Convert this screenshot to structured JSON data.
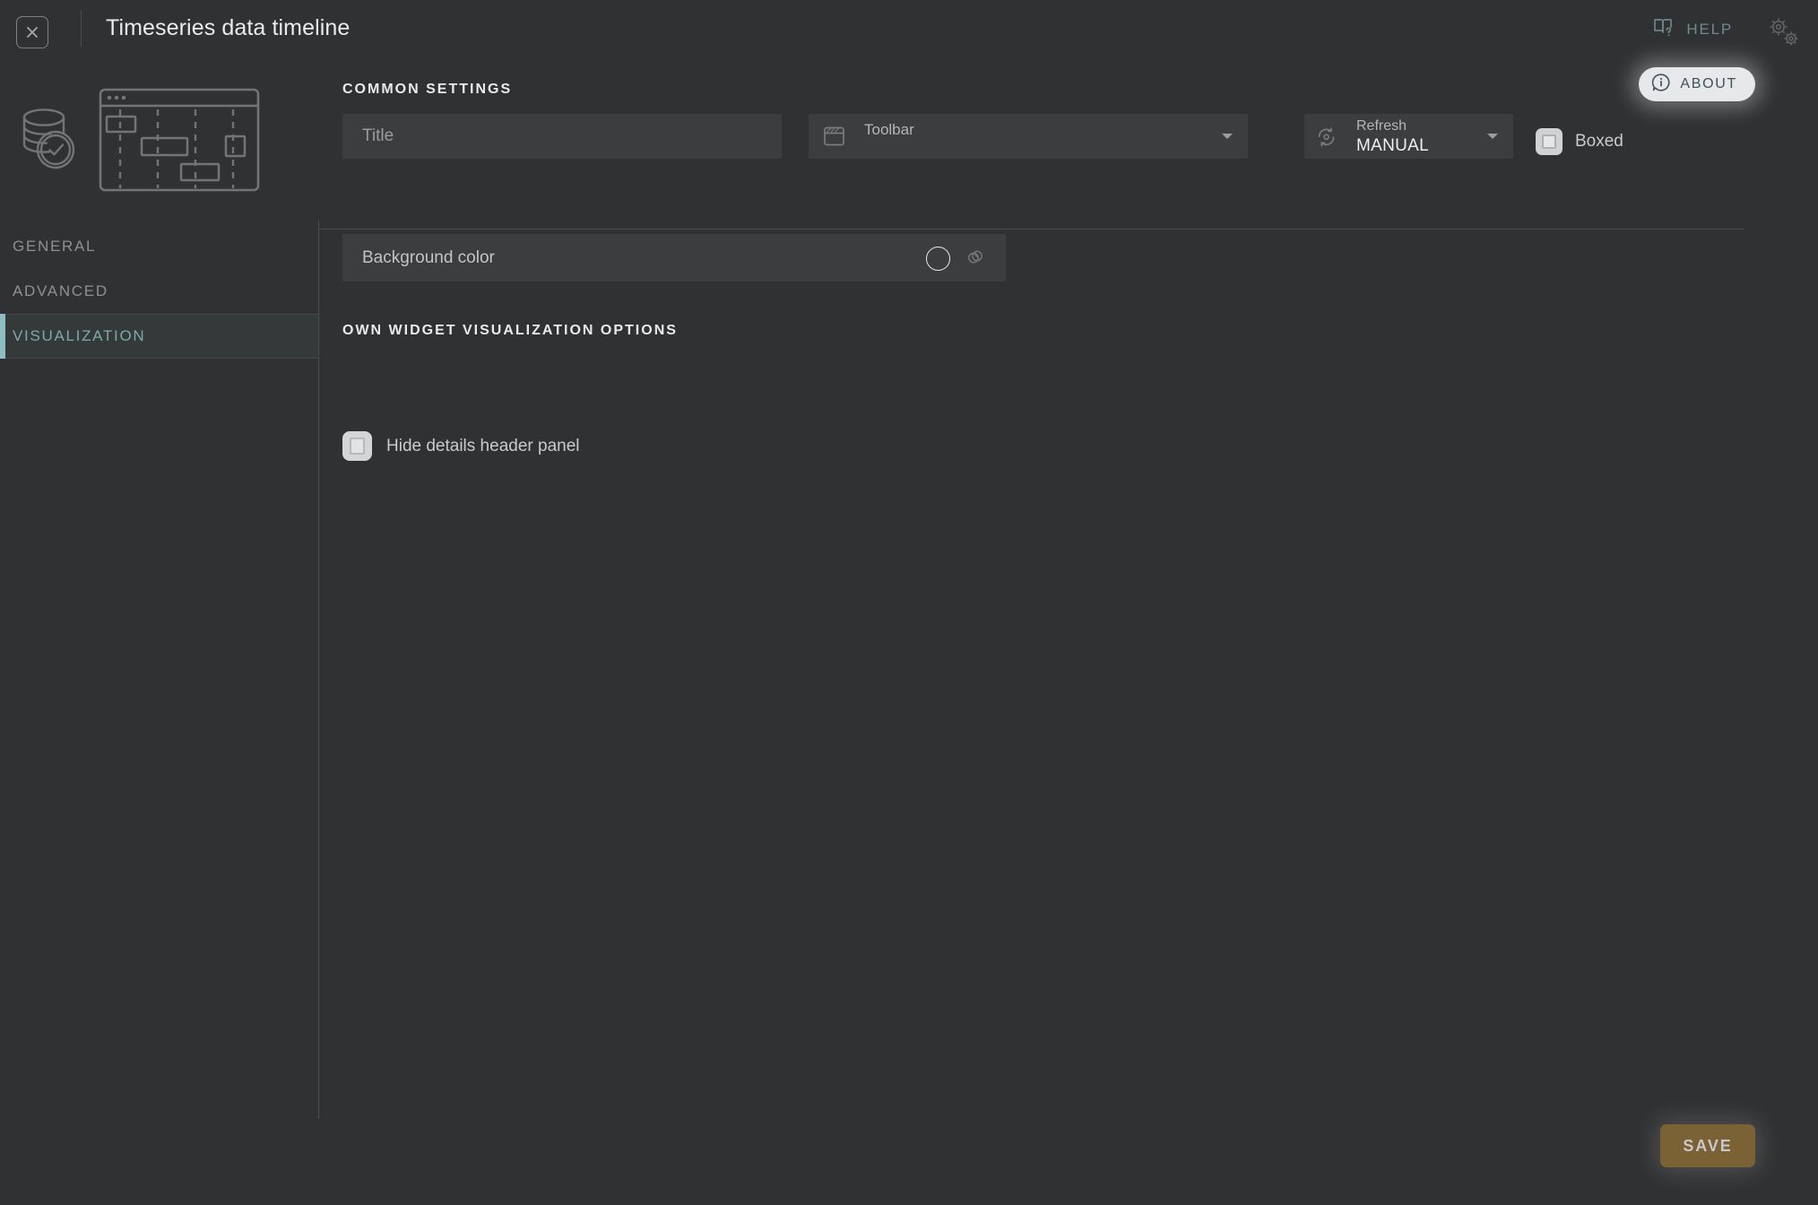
{
  "window": {
    "title": "Timeseries data timeline",
    "close_icon": "close-x-icon"
  },
  "header": {
    "help_label": "HELP",
    "help_icon": "book-question-icon",
    "settings_icon": "gears-icon",
    "about_label": "ABOUT",
    "about_icon": "info-circle-icon"
  },
  "sidebar": {
    "widget_type_icon": "database-clock-icon",
    "widget_preview_icon": "timeline-chart-icon",
    "items": [
      {
        "label": "GENERAL",
        "active": false
      },
      {
        "label": "ADVANCED",
        "active": false
      },
      {
        "label": "VISUALIZATION",
        "active": true
      }
    ]
  },
  "main": {
    "common_settings_heading": "COMMON SETTINGS",
    "own_options_heading": "OWN WIDGET VISUALIZATION OPTIONS",
    "title_field": {
      "placeholder": "Title",
      "value": ""
    },
    "toolbar_select": {
      "label": "Toolbar",
      "value": "",
      "icon": "window-panel-icon",
      "caret_icon": "chevron-down-icon"
    },
    "refresh_select": {
      "label": "Refresh",
      "value": "MANUAL",
      "icon": "refresh-sync-icon",
      "caret_icon": "chevron-down-icon"
    },
    "boxed_checkbox": {
      "label": "Boxed",
      "checked": false
    },
    "background_color_row": {
      "label": "Background color",
      "swatch_icon": "color-swatch-circle",
      "colorize_icon": "colorize-palette-icon"
    },
    "hide_details_checkbox": {
      "label": "Hide details header panel",
      "checked": false
    }
  },
  "footer": {
    "save_label": "SAVE"
  },
  "colors": {
    "background": "#2f3133",
    "surface": "#3b3d3f",
    "accent_teal": "#8fbec1",
    "accent_teal_text": "#7fa8ab",
    "save_amber": "#7b6235",
    "about_pill": "#e7e8e9",
    "divider": "#4a4c4e",
    "text_primary": "#e9ebec",
    "text_muted": "#8e9092"
  }
}
